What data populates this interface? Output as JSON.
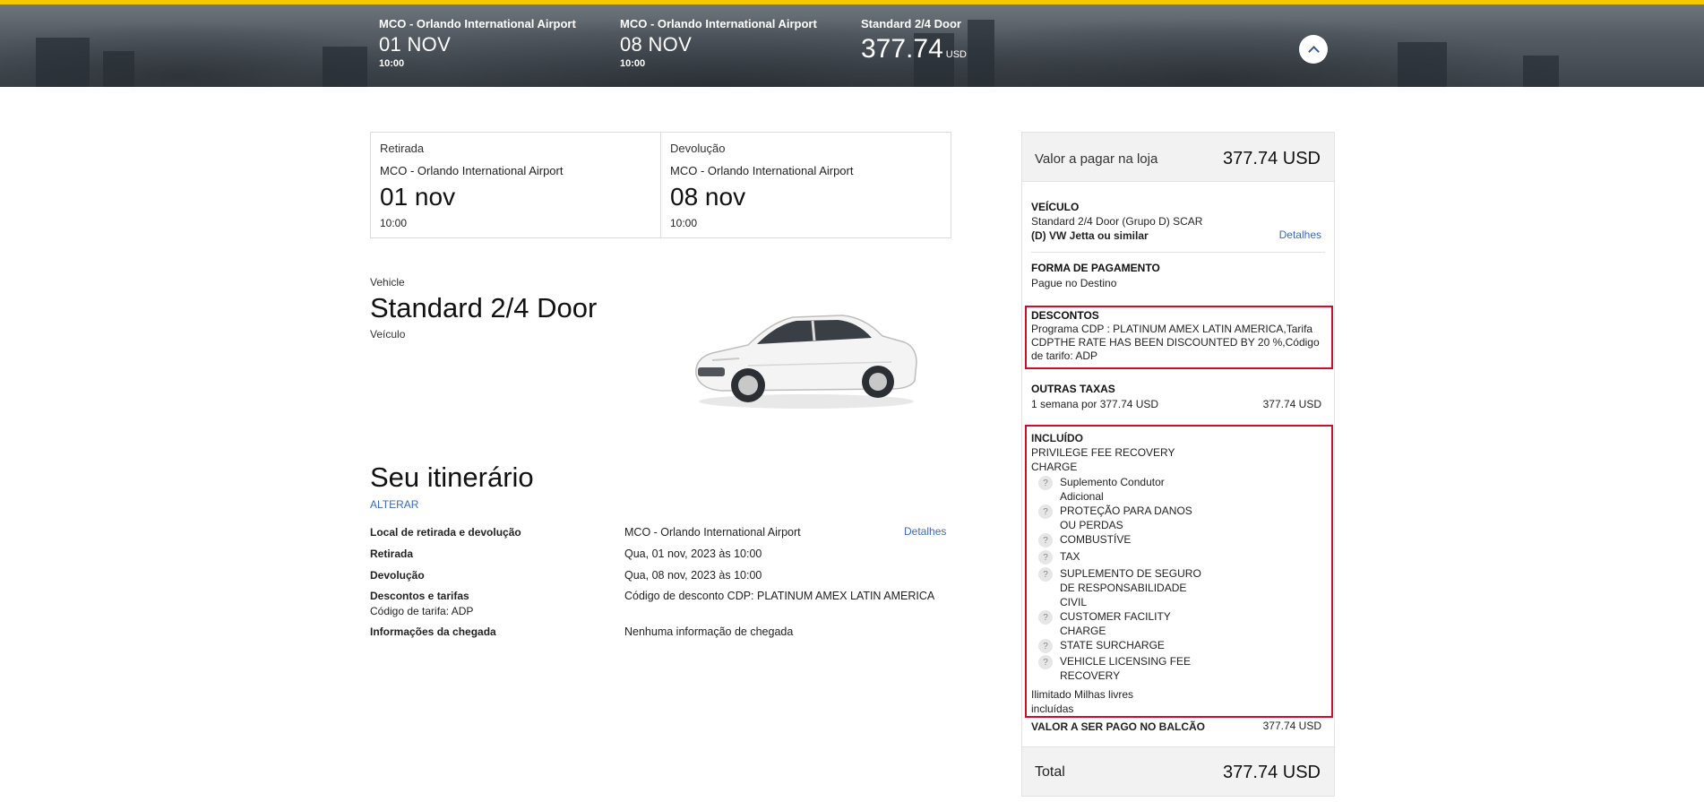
{
  "header": {
    "pickup": {
      "location": "MCO - Orlando International Airport",
      "date": "01 NOV",
      "time": "10:00"
    },
    "return": {
      "location": "MCO - Orlando International Airport",
      "date": "08 NOV",
      "time": "10:00"
    },
    "vehicle": {
      "name": "Standard 2/4 Door",
      "price": "377.74",
      "currency": "USD"
    }
  },
  "pickup_return": {
    "pickup": {
      "label": "Retirada",
      "location": "MCO - Orlando International Airport",
      "date": "01 nov",
      "time": "10:00"
    },
    "return": {
      "label": "Devolução",
      "location": "MCO - Orlando International Airport",
      "date": "08 nov",
      "time": "10:00"
    }
  },
  "vehicle": {
    "caption": "Vehicle",
    "name": "Standard 2/4 Door",
    "subtitle": "Veículo"
  },
  "itinerary": {
    "title": "Seu itinerário",
    "change_link": "ALTERAR",
    "details_link": "Detalhes",
    "rows": [
      {
        "label": "Local de retirada e devolução",
        "value": "MCO - Orlando International Airport"
      },
      {
        "label": "Retirada",
        "value": "Qua, 01 nov, 2023 às 10:00"
      },
      {
        "label": "Devolução",
        "value": "Qua, 08 nov, 2023 às 10:00"
      },
      {
        "label": "Descontos e tarifas",
        "sublabel": "Código de tarifa: ADP",
        "value": "Código de desconto CDP: PLATINUM AMEX LATIN AMERICA"
      },
      {
        "label": "Informações da chegada",
        "value": "Nenhuma informação de chegada"
      }
    ]
  },
  "summary": {
    "pay_at_store_label": "Valor a pagar na loja",
    "pay_at_store_value": "377.74 USD",
    "vehicle": {
      "heading": "VEÍCULO",
      "line1": "Standard 2/4 Door (Grupo D) SCAR",
      "line2": "(D) VW Jetta ou similar",
      "details_link": "Detalhes"
    },
    "payment": {
      "heading": "FORMA DE PAGAMENTO",
      "value": "Pague no Destino"
    },
    "discounts": {
      "heading": "DESCONTOS",
      "line1": "Programa CDP : PLATINUM AMEX LATIN AMERICA,Tarifa",
      "line2": "CDPTHE RATE HAS BEEN DISCOUNTED BY 20 %,Código",
      "line3": "de tarifo: ADP"
    },
    "other_fees": {
      "heading": "OUTRAS TAXAS",
      "desc": "1 semana por 377.74 USD",
      "value": "377.74 USD"
    },
    "included": {
      "heading": "INCLUÍDO",
      "lead1": "PRIVILEGE FEE RECOVERY",
      "lead2": "CHARGE",
      "items": [
        {
          "l1": "Suplemento Condutor",
          "l2": "Adicional"
        },
        {
          "l1": "PROTEÇÃO PARA DANOS",
          "l2": "OU PERDAS"
        },
        {
          "l1": "COMBUSTÍVE"
        },
        {
          "l1": "TAX"
        },
        {
          "l1": "SUPLEMENTO DE SEGURO",
          "l2": "DE RESPONSABILIDADE",
          "l3": "CIVIL"
        },
        {
          "l1": "CUSTOMER FACILITY",
          "l2": "CHARGE"
        },
        {
          "l1": "STATE SURCHARGE"
        },
        {
          "l1": "VEHICLE LICENSING FEE",
          "l2": "RECOVERY"
        }
      ],
      "tail1": "Ilimitado Milhas livres",
      "tail2": "incluídas",
      "help_glyph": "?"
    },
    "counter": {
      "label": "VALOR A SER PAGO NO BALCÃO",
      "value": "377.74 USD"
    },
    "total": {
      "label": "Total",
      "value": "377.74 USD"
    }
  },
  "colors": {
    "accent": "#f5c800",
    "link": "#3b6bb5",
    "highlight": "#c8102e"
  }
}
